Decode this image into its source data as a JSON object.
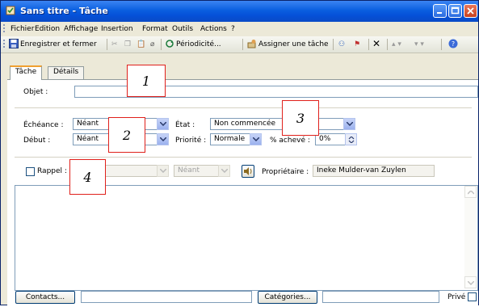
{
  "window": {
    "title": "Sans titre - Tâche"
  },
  "menu": [
    "Fichier",
    "Edition",
    "Affichage",
    "Insertion",
    "Format",
    "Outils",
    "Actions",
    "?"
  ],
  "toolbar": {
    "save_close": "Enregistrer et fermer",
    "recurrence": "Périodicité...",
    "assign": "Assigner une tâche"
  },
  "tabs": {
    "task": "Tâche",
    "details": "Détails"
  },
  "form": {
    "subject_label": "Objet :",
    "subject_value": "",
    "due_label": "Échéance :",
    "due_value": "Néant",
    "start_label": "Début :",
    "start_value": "Néant",
    "status_label": "État :",
    "status_value": "Non commencée",
    "priority_label": "Priorité :",
    "priority_value": "Normale",
    "percent_label": "% achevé :",
    "percent_value": "0%",
    "reminder_label": "Rappel :",
    "reminder_time": "Néant",
    "owner_label": "Propriétaire :",
    "owner_value": "Ineke Mulder-van Zuylen",
    "notes": ""
  },
  "footer": {
    "contacts_button": "Contacts...",
    "categories_button": "Catégories...",
    "private_label": "Privé"
  },
  "callouts": [
    "1",
    "2",
    "3",
    "4"
  ],
  "colors": {
    "titlebar": "#0a5fe0",
    "callout_border": "#e0201b",
    "tab_accent": "#f0a030"
  }
}
